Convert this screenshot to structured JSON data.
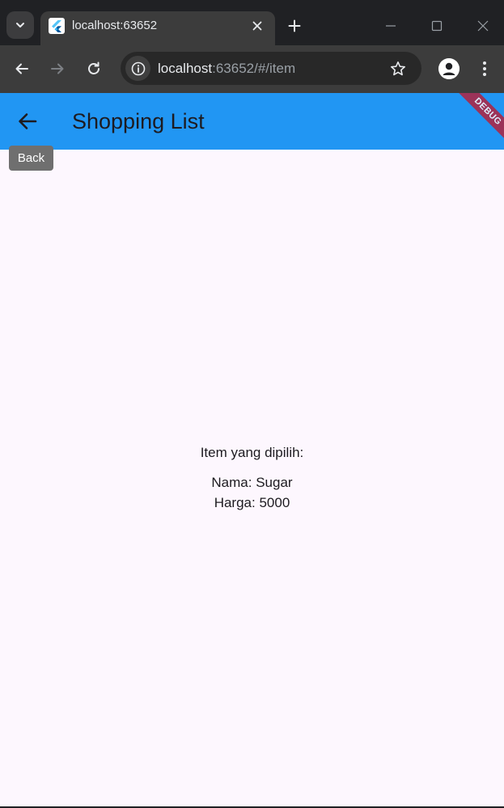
{
  "browser": {
    "tab": {
      "title": "localhost:63652"
    },
    "address_bar": {
      "host": "localhost",
      "path": ":63652/#/item"
    },
    "icons": {
      "tab_search": "chevron-down-icon",
      "favicon": "flutter-icon",
      "tab_close": "close-icon",
      "new_tab": "plus-icon",
      "minimize": "minimize-icon",
      "maximize": "maximize-icon",
      "close_window": "close-window-icon",
      "back": "arrow-left-icon",
      "forward": "arrow-right-icon",
      "reload": "reload-icon",
      "site_info": "info-icon",
      "bookmark": "star-icon",
      "profile": "profile-icon",
      "menu": "kebab-menu-icon"
    }
  },
  "app": {
    "appbar": {
      "title": "Shopping List",
      "color": "#2196f3"
    },
    "debug_banner": "DEBUG",
    "back_tooltip": "Back",
    "detail": {
      "heading": "Item yang dipilih:",
      "name_line": "Nama: Sugar",
      "price_line": "Harga: 5000"
    },
    "background": "#fdf7fe"
  }
}
